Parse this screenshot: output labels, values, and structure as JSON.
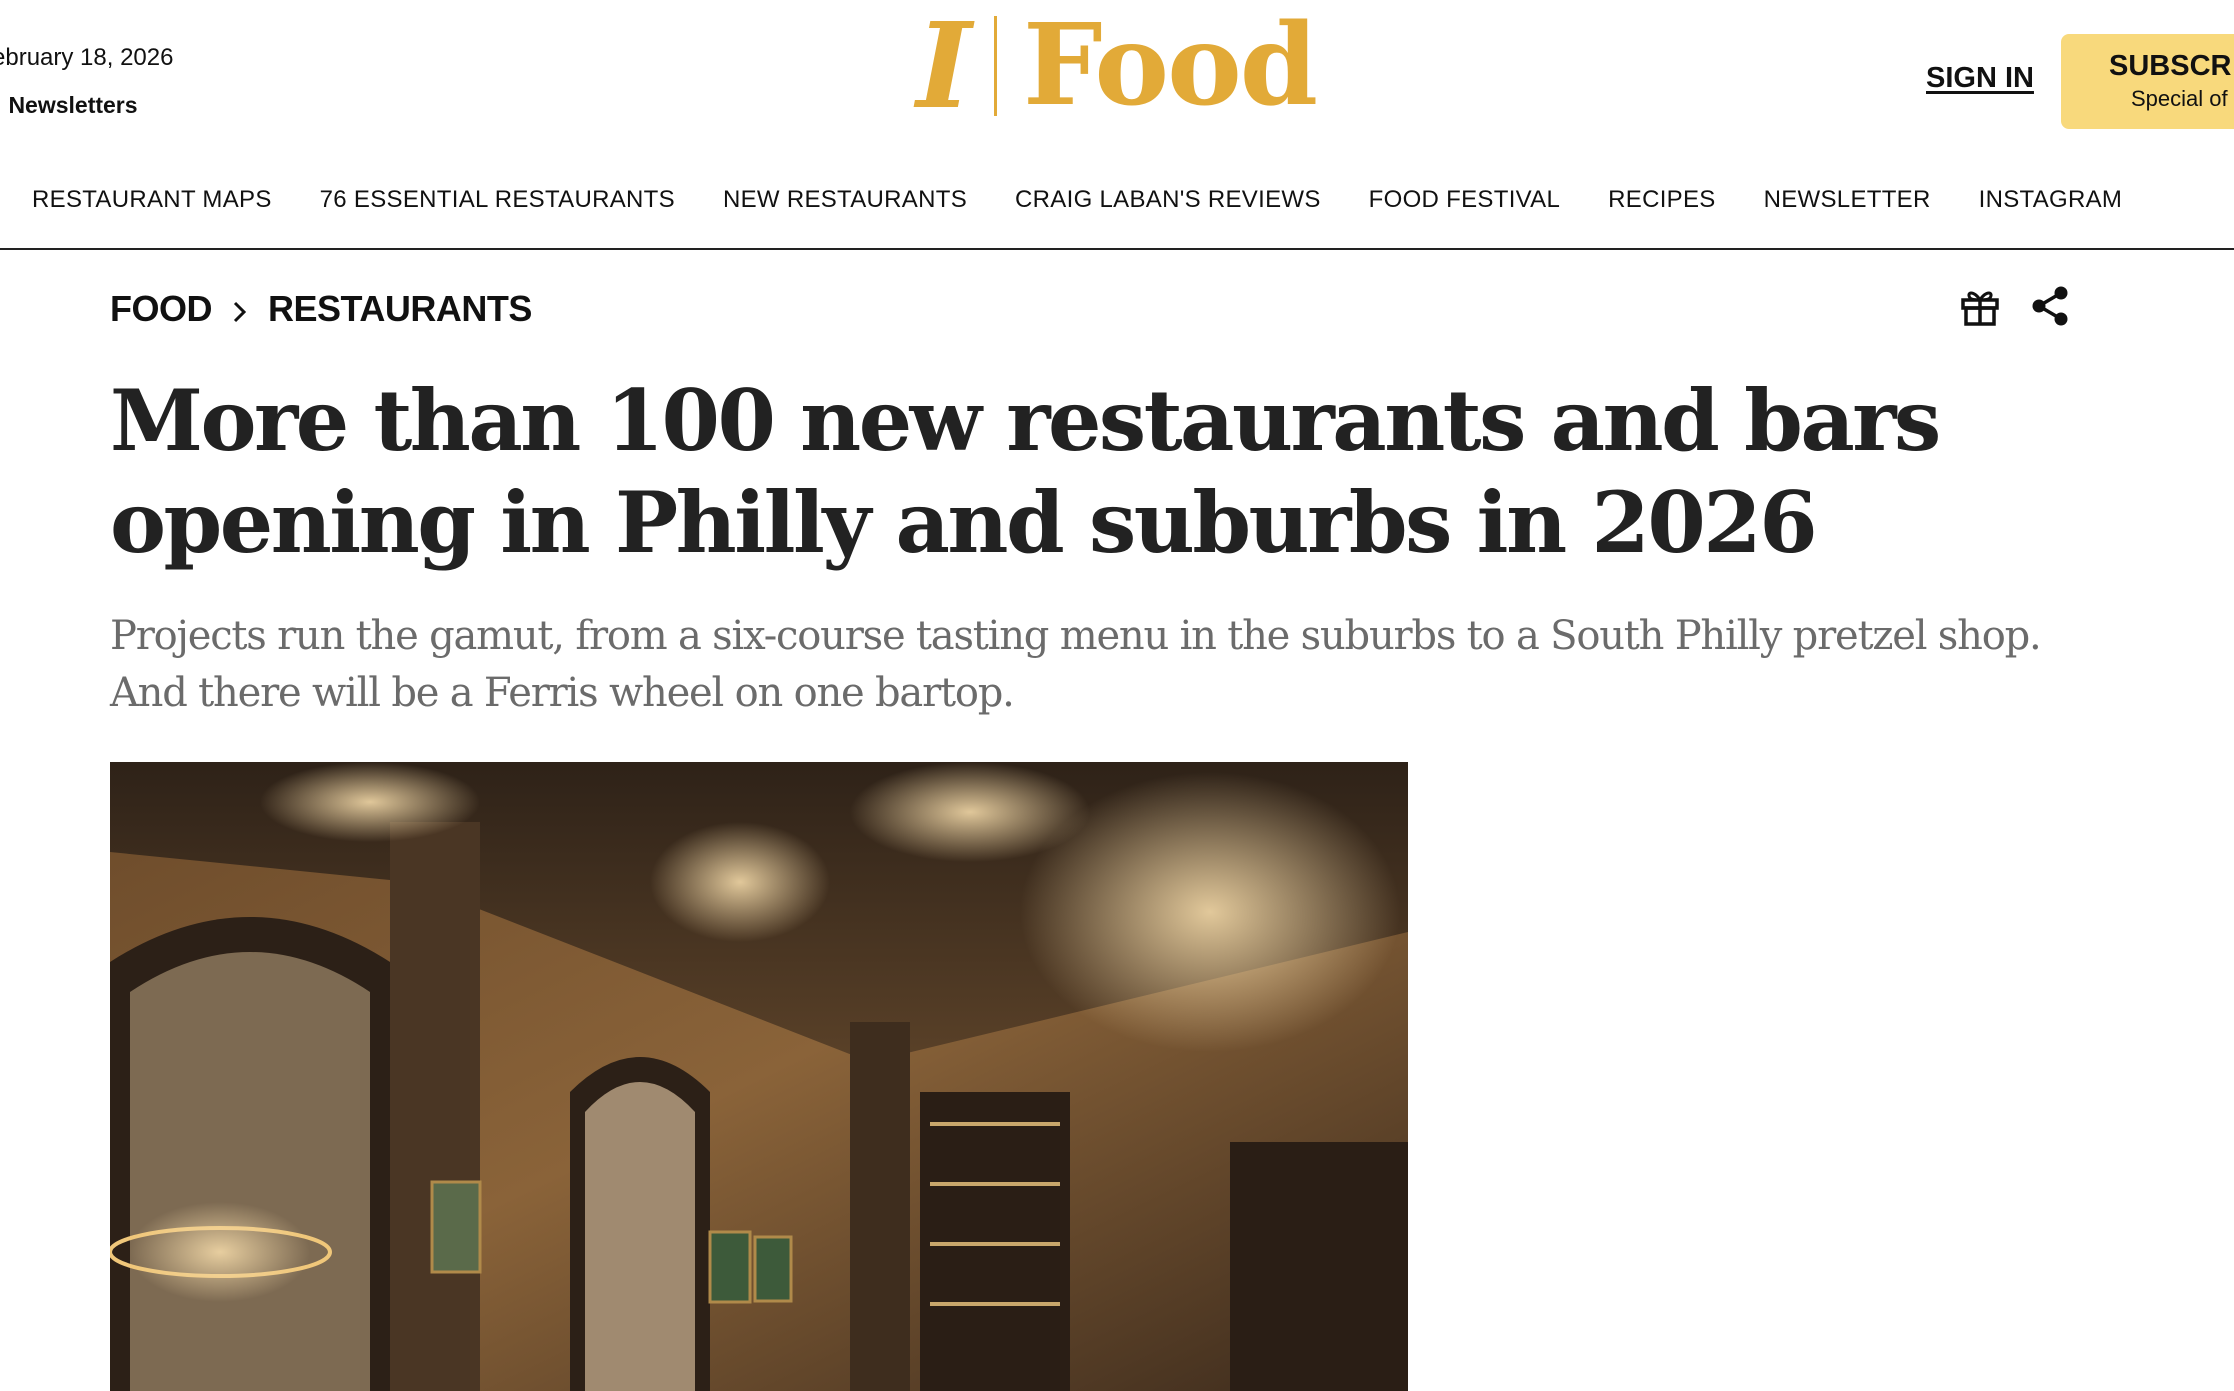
{
  "header": {
    "date": "ebruary 18, 2026",
    "links_separator": "|",
    "newsletters_label": "Newsletters",
    "logo_section": "Food",
    "sign_in_label": "SIGN IN",
    "subscribe_label": "SUBSCR",
    "subscribe_note": "Special of"
  },
  "nav": {
    "items": [
      "RESTAURANT MAPS",
      "76 ESSENTIAL RESTAURANTS",
      "NEW RESTAURANTS",
      "CRAIG LABAN'S REVIEWS",
      "FOOD FESTIVAL",
      "RECIPES",
      "NEWSLETTER",
      "INSTAGRAM"
    ]
  },
  "breadcrumb": {
    "section": "FOOD",
    "subsection": "RESTAURANTS"
  },
  "article": {
    "headline": "More than 100 new restaurants and bars opening in Philly and suburbs in 2026",
    "dek": "Projects run the gamut, from a six-course tasting menu in the suburbs to a South Philly pretzel shop. And there will be a Ferris wheel on one bartop."
  },
  "icons": {
    "gift": "gift-icon",
    "share": "share-icon",
    "chevron": "chevron-right-icon"
  },
  "colors": {
    "brand_gold": "#e2aa38",
    "subscribe_bg": "#f8d97c",
    "dek_gray": "#6b6b6b",
    "headline": "#222222"
  }
}
